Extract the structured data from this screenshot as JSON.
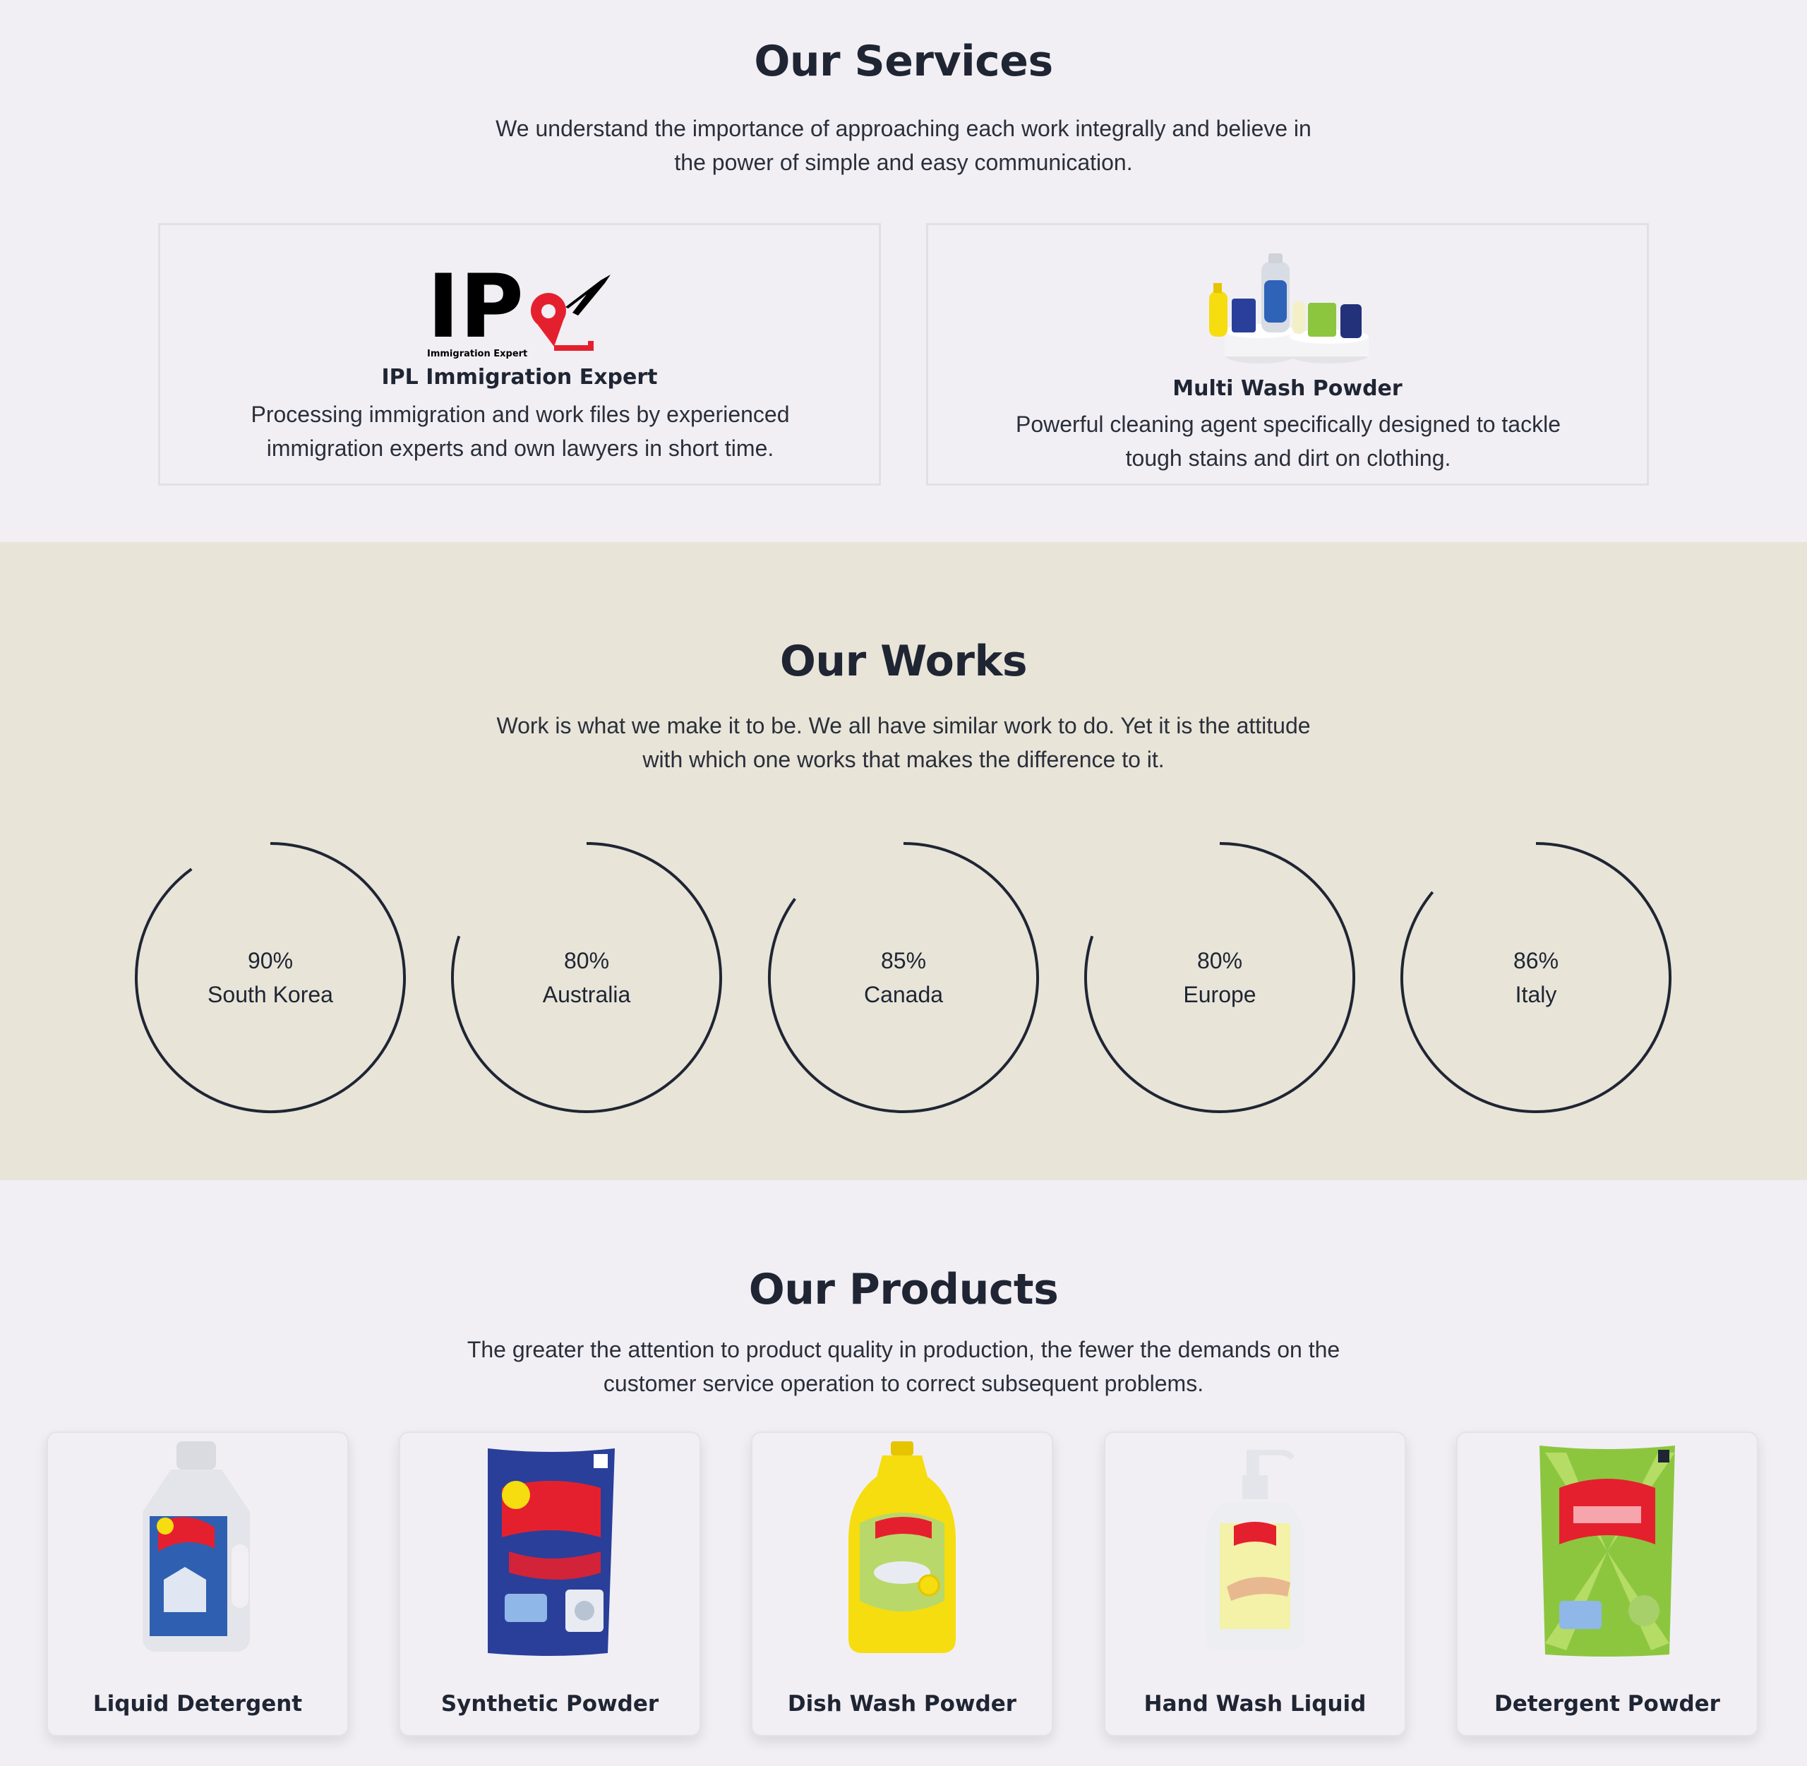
{
  "services": {
    "title": "Our Services",
    "subtitle": "We understand the importance of approaching each work integrally and believe in the power of simple and easy communication.",
    "cards": [
      {
        "logo_text": "IP",
        "logo_caption": "Immigration Expert",
        "title": "IPL Immigration Expert",
        "description": "Processing immigration and work files by experienced immigration experts and own lawyers in short time."
      },
      {
        "title": "Multi Wash Powder",
        "description": "Powerful cleaning agent specifically designed to tackle tough stains and dirt on clothing."
      }
    ]
  },
  "works": {
    "title": "Our Works",
    "subtitle": "Work is what we make it to be. We all have similar work to do. Yet it is the attitude with which one works that makes the difference to it.",
    "stats": [
      {
        "value_label": "90%",
        "name": "South Korea",
        "percent": 90
      },
      {
        "value_label": "80%",
        "name": "Australia",
        "percent": 80
      },
      {
        "value_label": "85%",
        "name": "Canada",
        "percent": 85
      },
      {
        "value_label": "80%",
        "name": "Europe",
        "percent": 80
      },
      {
        "value_label": "86%",
        "name": "Italy",
        "percent": 86
      }
    ]
  },
  "products": {
    "title": "Our Products",
    "subtitle": "The greater the attention to product quality in production, the fewer the demands on the customer service operation to correct subsequent problems.",
    "items": [
      {
        "name": "Liquid Detergent",
        "icon": "liquid-detergent-bottle"
      },
      {
        "name": "Synthetic Powder",
        "icon": "synthetic-powder-pack"
      },
      {
        "name": "Dish Wash Powder",
        "icon": "dish-wash-bottle"
      },
      {
        "name": "Hand Wash Liquid",
        "icon": "hand-wash-pump-bottle"
      },
      {
        "name": "Detergent Powder",
        "icon": "detergent-powder-pack"
      }
    ]
  },
  "colors": {
    "page_bg": "#f1eff4",
    "works_bg": "#e8e4d8",
    "text_dark": "#1f2533",
    "brand_red": "#e5202e",
    "brand_blue": "#2a3f9a",
    "brand_green": "#8cc63f",
    "brand_yellow": "#f5dd10"
  }
}
